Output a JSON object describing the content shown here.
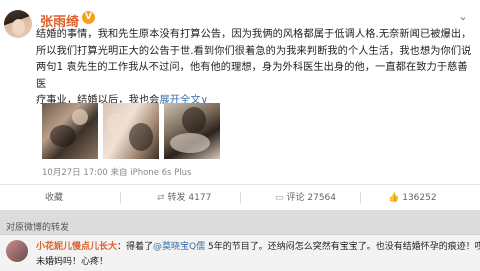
{
  "post": {
    "user_name": "张雨绮",
    "verified_badge": "V",
    "content_lines": [
      "结婚的事情，我和先生原本没有打算公告，因为我俩的风格都属于低调人格.无奈新闻已被爆出，",
      "所以我们打算光明正大的公告于世.看到你们很着急的为我来判断我的个人生活，我也想为你们说",
      "两句1 袁先生的工作我从不过问，他有他的理想，身为外科医生出身的他，一直都在致力于慈善医",
      "疗事业，结婚以后，我也会"
    ],
    "expand_link": "展开全文∨",
    "timestamp": "10月27日 17:00 来自 iPhone 6s Plus",
    "actions": {
      "favorite": "收藏",
      "repost": "转发 4177",
      "comment": "评论 27564",
      "like": "136252"
    }
  },
  "reply_section": {
    "title": "对原微博的转发",
    "comment_user": "小花妮儿慢点儿长大",
    "comment_text_before": "：得着了",
    "comment_mention": "@莫晓宝Q儒",
    "comment_text_after": " 5年的节目了。还纳闷怎么突然有宝宝了。也没有结婚怀孕的痕迹！哎！",
    "comment_line2": "未婚妈吗！心疼！"
  }
}
